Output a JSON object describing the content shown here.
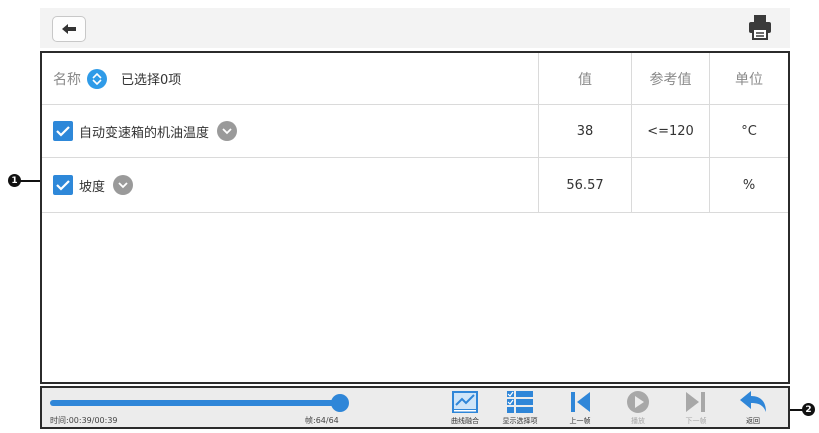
{
  "header": {
    "back_icon": "arrow-left-icon",
    "print_icon": "printer-icon"
  },
  "table": {
    "header": {
      "name": "名称",
      "selected": "已选择0项",
      "value": "值",
      "reference": "参考值",
      "unit": "单位"
    },
    "rows": [
      {
        "name": "自动变速箱的机油温度",
        "checked": true,
        "value": "38",
        "reference": "<=120",
        "unit": "°C"
      },
      {
        "name": "坡度",
        "checked": true,
        "value": "56.57",
        "reference": "",
        "unit": "%"
      }
    ]
  },
  "playback": {
    "time": "时间:00:39/00:39",
    "frame": "帧:64/64",
    "progress": 1.0,
    "accent": "#2f86d8",
    "buttons": [
      {
        "label": "曲线融合",
        "icon": "line-chart-icon",
        "enabled": true
      },
      {
        "label": "显示选择项",
        "icon": "checklist-icon",
        "enabled": true
      },
      {
        "label": "上一帧",
        "icon": "previous-frame-icon",
        "enabled": true
      },
      {
        "label": "播放",
        "icon": "play-icon",
        "enabled": false
      },
      {
        "label": "下一帧",
        "icon": "next-frame-icon",
        "enabled": false
      },
      {
        "label": "返回",
        "icon": "return-icon",
        "enabled": true
      }
    ]
  },
  "callouts": {
    "one": "1",
    "two": "2"
  }
}
